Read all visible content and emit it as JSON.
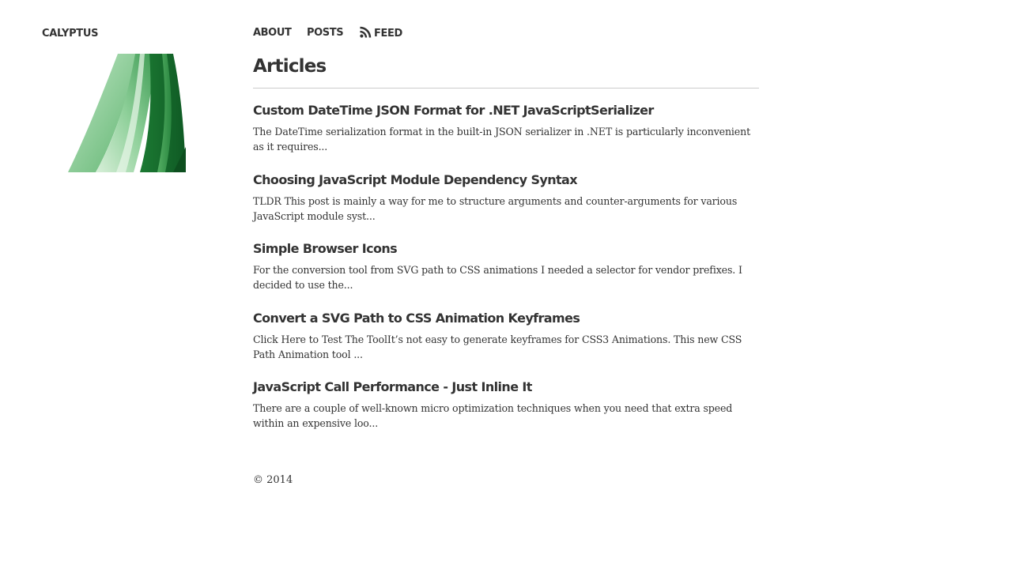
{
  "site": {
    "title": "CALYPTUS"
  },
  "nav": {
    "about": "ABOUT",
    "posts": "POSTS",
    "feed": "FEED"
  },
  "main": {
    "title": "Articles",
    "posts": [
      {
        "title": "Custom DateTime JSON Format for .NET JavaScriptSerializer",
        "excerpt": "The DateTime serialization format in the built-in JSON serializer in .NET is particularly inconvenient as ",
        "more": "it requires..."
      },
      {
        "title": "Choosing JavaScript Module Dependency Syntax",
        "excerpt": "TLDR This post is mainly a way for me to structure arguments and counter-arguments for various ",
        "more": "JavaScript module syst..."
      },
      {
        "title": "Simple Browser Icons",
        "excerpt": "For the conversion tool from SVG path to CSS animations I needed a selector for vendor prefixes. I ",
        "more": "decided to use the..."
      },
      {
        "title": "Convert a SVG Path to CSS Animation Keyframes",
        "excerpt": "Click Here to Test The ToolIt’s not easy to generate keyframes for CSS3 Animations. This new CSS Path ",
        "more": "Animation tool ..."
      },
      {
        "title": "JavaScript Call Performance - Just Inline It",
        "excerpt": "There are a couple of well-known micro optimization techniques when you need that extra speed within ",
        "more": "an expensive loo..."
      }
    ]
  },
  "footer": {
    "copyright": "© 2014"
  },
  "icons": {
    "feed": "rss-icon",
    "logo": "leaf-logo-image"
  },
  "colors": {
    "text": "#333333",
    "divider": "#cccccc",
    "background": "#ffffff"
  }
}
